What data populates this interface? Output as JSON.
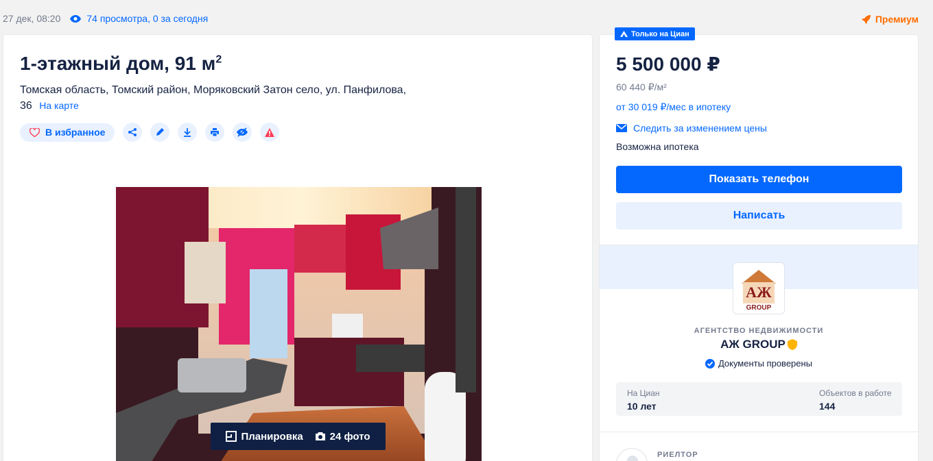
{
  "meta": {
    "date": "27 дек, 08:20",
    "views": "74 просмотра, 0 за сегодня",
    "premium": "Премиум"
  },
  "listing": {
    "title": "1-этажный дом, 91 м",
    "title_sup": "2",
    "address": "Томская область, Томский район, Моряковский Затон село, ул. Панфилова, 36",
    "map_link": "На карте",
    "favorite_label": "В избранное",
    "action_icons": [
      "share-icon",
      "edit-icon",
      "download-icon",
      "print-icon",
      "hide-icon",
      "report-icon"
    ],
    "photo": {
      "plan_label": "Планировка",
      "photos_label": "24 фото"
    }
  },
  "sidebar": {
    "only_cian": "Только на Циан",
    "price": "5 500 000 ₽",
    "price_per_m": "60 440 ₽/м²",
    "mortgage_link": "от 30 019 ₽/мес в ипотеку",
    "track_price": "Следить за изменением цены",
    "mortgage_possible": "Возможна ипотека",
    "show_phone": "Показать телефон",
    "write": "Написать",
    "agency": {
      "logo_text": "АЖ",
      "logo_sub": "GROUP",
      "kind": "АГЕНТСТВО НЕДВИЖИМОСТИ",
      "name": "АЖ GROUP",
      "docs_verified": "Документы проверены",
      "on_cian_label": "На Циан",
      "on_cian_value": "10 лет",
      "objects_label": "Объектов в работе",
      "objects_value": "144"
    },
    "realtor_label": "РИЕЛТОР"
  },
  "colors": {
    "accent": "#0468ff",
    "premium": "#ff6d00",
    "text": "#152242",
    "muted": "#737a8e"
  }
}
